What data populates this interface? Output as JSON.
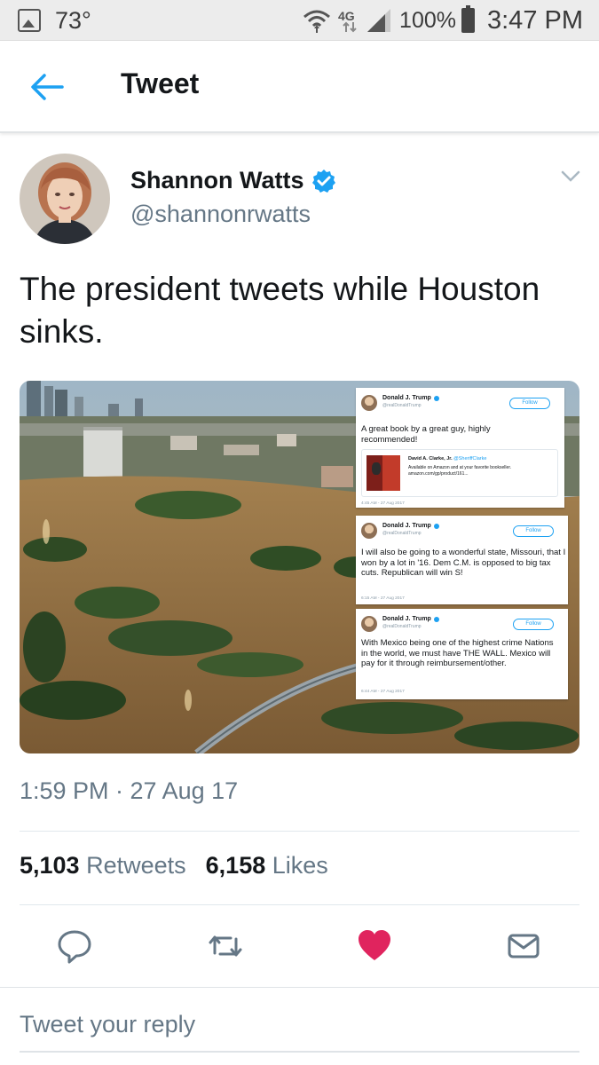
{
  "status_bar": {
    "temperature": "73°",
    "network": "4G",
    "battery": "100%",
    "time": "3:47 PM"
  },
  "header": {
    "title": "Tweet"
  },
  "tweet": {
    "author_name": "Shannon Watts",
    "author_handle": "@shannonrwatts",
    "text": "The president tweets while Houston sinks.",
    "timestamp": "1:59 PM · 27 Aug 17",
    "retweets_count": "5,103",
    "retweets_label": "Retweets",
    "likes_count": "6,158",
    "likes_label": "Likes",
    "liked": true,
    "like_color": "#e0245e",
    "accent_color": "#1da1f2"
  },
  "embedded_tweets": [
    {
      "name": "Donald J. Trump",
      "handle": "@realDonaldTrump",
      "follow_label": "Follow",
      "text": "A great book by a great guy, highly recommended!",
      "time": "4:45 AM - 27 Aug 2017",
      "quote": {
        "name": "David A. Clarke, Jr.",
        "handle": "@SheriffClarke",
        "line1": "Available on Amazon and at your favorite bookseller.",
        "line2": "amazon.com/gp/product/161..."
      }
    },
    {
      "name": "Donald J. Trump",
      "handle": "@realDonaldTrump",
      "follow_label": "Follow",
      "text": "I will also be going to a wonderful state, Missouri, that I won by a lot in '16. Dem C.M. is opposed to big tax cuts. Republican will win S!",
      "time": "6:15 AM - 27 Aug 2017"
    },
    {
      "name": "Donald J. Trump",
      "handle": "@realDonaldTrump",
      "follow_label": "Follow",
      "text": "With Mexico being one of the highest crime Nations in the world, we must have THE WALL. Mexico will pay for it through reimbursement/other.",
      "time": "6:44 AM - 27 Aug 2017"
    }
  ],
  "actions": {
    "reply_icon": "reply-icon",
    "retweet_icon": "retweet-icon",
    "like_icon": "heart-icon",
    "dm_icon": "envelope-icon"
  },
  "reply": {
    "placeholder": "Tweet your reply"
  }
}
